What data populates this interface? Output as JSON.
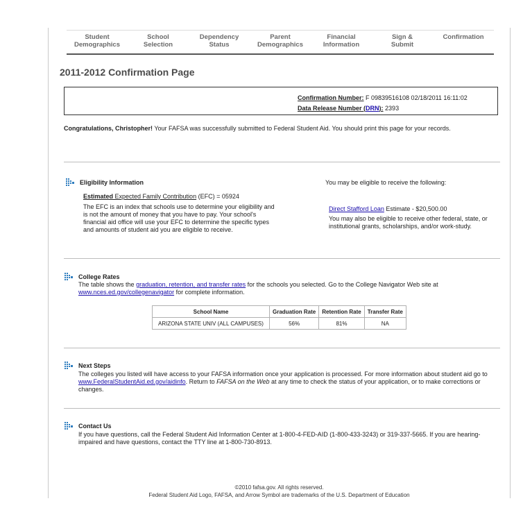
{
  "steps": [
    "Student\nDemographics",
    "School\nSelection",
    "Dependency\nStatus",
    "Parent\nDemographics",
    "Financial\nInformation",
    "Sign &\nSubmit",
    "Confirmation"
  ],
  "page_title": "2011-2012 Confirmation Page",
  "confirmation": {
    "number_label": "Confirmation Number:",
    "number_value": " F 09839516108 02/18/2011 16:11:02",
    "drn_label_pre": "Data Release Number (",
    "drn_link": "DRN",
    "drn_label_post": "):",
    "drn_value": " 2393"
  },
  "congrats": {
    "bold": "Congratulations, Christopher!",
    "text": " Your FAFSA was successfully submitted to Federal Student Aid. You should print this page for your records."
  },
  "eligibility": {
    "title": "Eligibility Information",
    "efc_bold": "Estimated",
    "efc_link": " Expected Family Contribution",
    "efc_rest": " (EFC) = 05924",
    "desc": "The EFC is an index that schools use to determine your eligibility and is not the amount of money that you have to pay. Your school's financial aid office will use your EFC to determine the specific types and amounts of student aid you are eligible to receive.",
    "right_title": "You may be eligible to receive the following:",
    "stafford_link": "Direct Stafford Loan",
    "stafford_rest": " Estimate - $20,500.00",
    "other": "You may also be eligible to receive other federal, state, or institutional grants, scholarships, and/or work-study."
  },
  "college_rates": {
    "title": "College Rates",
    "text1": "The table shows the ",
    "link1": "graduation, retention, and transfer rates",
    "text2": " for the schools you selected. Go to the College Navigator Web site at ",
    "link2": "www.nces.ed.gov/collegenavigator",
    "text3": " for complete information.",
    "headers": [
      "School Name",
      "Graduation Rate",
      "Retention Rate",
      "Transfer Rate"
    ],
    "rows": [
      [
        "ARIZONA STATE UNIV (ALL CAMPUSES)",
        "56%",
        "81%",
        "NA"
      ]
    ]
  },
  "next_steps": {
    "title": "Next Steps",
    "text1": "The colleges you listed will have access to your FAFSA information once your application is processed. For more information about student aid go to ",
    "link": "www.FederalStudentAid.ed.gov/aidinfo",
    "text2": ". Return to ",
    "italic": "FAFSA on the Web",
    "text3": " at any time to check the status of your application, or to make corrections or changes."
  },
  "contact": {
    "title": "Contact Us",
    "text": "If you have questions, call the Federal Student Aid Information Center at 1-800-4-FED-AID (1-800-433-3243) or 319-337-5665. If you are hearing-impaired and have questions, contact the TTY line at 1-800-730-8913."
  },
  "footer": {
    "line1": "©2010 fafsa.gov. All rights reserved.",
    "line2": "Federal Student Aid Logo, FAFSA, and Arrow Symbol are trademarks of the U.S. Department of Education"
  },
  "colors": {
    "icon": "#2e7dbf",
    "link": "#1a0dab"
  },
  "icons": {
    "section": "arrow-grid-icon"
  }
}
